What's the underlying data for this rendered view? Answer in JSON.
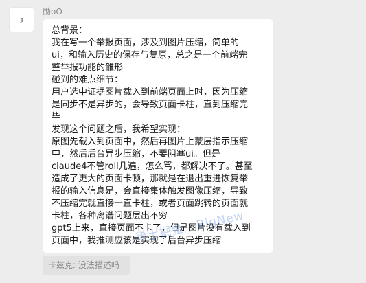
{
  "sender": {
    "avatar_text": "ȝ",
    "name": "勋oO"
  },
  "message": {
    "lines": [
      "总背景：",
      "我在写一个举报页面，涉及到图片压缩，简单的",
      "ui，和输入历史的保存与复原，总之是一个前端完",
      "整举报功能的雏形",
      "碰到的难点细节：",
      "用户选中证据图片载入到前端页面上时，因为压缩",
      "是同步不是异步的，会导致页面卡柱，直到压缩完",
      "毕",
      "发现这个问题之后，我希望实现：",
      "原图先载入到页面中，然后再图片上蒙层指示压缩",
      "中，然后后台异步压缩，不要阻塞ui。但是",
      "claude4不管roll几遍，怎么骂，都解决不了。甚至",
      "造成了更大的页面卡顿，那就是在退出重进恢复举",
      "报的输入信息是，会直接集体触发图像压缩，导致",
      "不压缩完就直接一直卡柱，或者页面跳转的页面就",
      "卡柱，各种离谱问题层出不穷",
      "gpt5上来，直接页面不卡了，但是图片没有载入到",
      "页面中，我推测应该是实现了后台异步压缩"
    ]
  },
  "watermark": "稀土掘金 · BigNew",
  "quote": {
    "text": "卡兹克: 没法描述吗"
  }
}
